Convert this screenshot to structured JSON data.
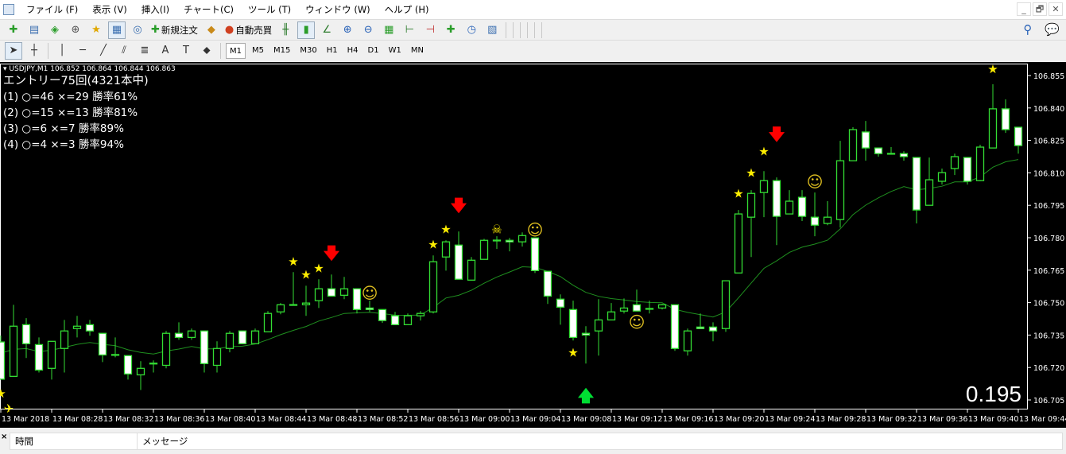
{
  "menu": [
    "ファイル (F)",
    "表示 (V)",
    "挿入(I)",
    "チャート(C)",
    "ツール (T)",
    "ウィンドウ (W)",
    "ヘルプ (H)"
  ],
  "window_controls": {
    "minimize": "_",
    "restore": "🗗",
    "close": "✕"
  },
  "toolbar1": [
    {
      "icon": "new-chart-icon",
      "glyph": "✚",
      "color": "#2a9d2a",
      "label": ""
    },
    {
      "icon": "profiles-icon",
      "glyph": "▤",
      "color": "#3b6fb0",
      "label": ""
    },
    {
      "sep": true
    },
    {
      "icon": "market-watch-icon",
      "glyph": "◈",
      "color": "#2a9d2a",
      "label": ""
    },
    {
      "icon": "data-window-icon",
      "glyph": "⊕",
      "color": "#555",
      "label": ""
    },
    {
      "icon": "navigator-icon",
      "glyph": "★",
      "color": "#e0a800",
      "label": ""
    },
    {
      "icon": "terminal-icon",
      "glyph": "▦",
      "color": "#3b6fb0",
      "label": "",
      "active": true
    },
    {
      "icon": "strategy-tester-icon",
      "glyph": "◎",
      "color": "#3b6fb0",
      "label": ""
    },
    {
      "sep": true
    },
    {
      "icon": "new-order-icon",
      "glyph": "✚",
      "color": "#2a9d2a",
      "label": "新規注文"
    },
    {
      "icon": "metaeditor-icon",
      "glyph": "◆",
      "color": "#c98a1a",
      "label": ""
    },
    {
      "icon": "autotrading-icon",
      "glyph": "●",
      "color": "#d04020",
      "label": "自動売買"
    },
    {
      "sep": true
    },
    {
      "icon": "bar-chart-icon",
      "glyph": "╫",
      "color": "#2a7a2a",
      "label": ""
    },
    {
      "icon": "candlestick-chart-icon",
      "glyph": "▮",
      "color": "#2a9d2a",
      "label": "",
      "active": true
    },
    {
      "icon": "line-chart-icon",
      "glyph": "∠",
      "color": "#2a7a2a",
      "label": ""
    },
    {
      "sep": true
    },
    {
      "icon": "zoom-in-icon",
      "glyph": "⊕",
      "color": "#2a63b8",
      "label": ""
    },
    {
      "icon": "zoom-out-icon",
      "glyph": "⊖",
      "color": "#2a63b8",
      "label": ""
    },
    {
      "icon": "tile-windows-icon",
      "glyph": "▦",
      "color": "#2a9d2a",
      "label": ""
    },
    {
      "sep": true
    },
    {
      "icon": "chart-shift-icon",
      "glyph": "⊢",
      "color": "#2a7a2a",
      "label": ""
    },
    {
      "icon": "autoscroll-icon",
      "glyph": "⊣",
      "color": "#c03030",
      "label": ""
    },
    {
      "sep": true
    },
    {
      "icon": "indicators-icon",
      "glyph": "✚",
      "color": "#2a9d2a",
      "label": ""
    },
    {
      "icon": "periods-icon",
      "glyph": "◷",
      "color": "#2a63b8",
      "label": ""
    },
    {
      "icon": "templates-icon",
      "glyph": "▧",
      "color": "#3b6fb0",
      "label": ""
    }
  ],
  "toolbar1_right": [
    {
      "icon": "search-icon",
      "glyph": "⚲"
    },
    {
      "icon": "chat-icon",
      "glyph": "💬"
    }
  ],
  "toolbar2_tools": [
    {
      "icon": "cursor-icon",
      "glyph": "➤"
    },
    {
      "icon": "crosshair-icon",
      "glyph": "┼"
    },
    {
      "sep": true
    },
    {
      "icon": "vertical-line-icon",
      "glyph": "│"
    },
    {
      "icon": "horizontal-line-icon",
      "glyph": "─"
    },
    {
      "icon": "trendline-icon",
      "glyph": "╱"
    },
    {
      "icon": "equidistant-channel-icon",
      "glyph": "⫽"
    },
    {
      "icon": "fibonacci-icon",
      "glyph": "≣"
    },
    {
      "icon": "text-icon",
      "glyph": "A"
    },
    {
      "icon": "text-label-icon",
      "glyph": "T"
    },
    {
      "icon": "arrows-icon",
      "glyph": "⬥"
    }
  ],
  "timeframes": [
    "M1",
    "M5",
    "M15",
    "M30",
    "H1",
    "H4",
    "D1",
    "W1",
    "MN"
  ],
  "active_timeframe": "M1",
  "chart": {
    "header": "USDJPY,M1  106.852 106.864 106.844 106.863",
    "stats": [
      "エントリー75回(4321本中)",
      "(1) ○=46 ×=29 勝率61%",
      "(2) ○=15 ×=13 勝率81%",
      "(3) ○=6 ×=7 勝率89%",
      "(4) ○=4 ×=3 勝率94%"
    ],
    "big_value": "0.195"
  },
  "chart_data": {
    "type": "candlestick",
    "symbol": "USDJPY",
    "timeframe": "M1",
    "ylim": [
      106.7,
      106.86
    ],
    "yticks": [
      "106.855",
      "106.840",
      "106.825",
      "106.810",
      "106.795",
      "106.780",
      "106.765",
      "106.750",
      "106.735",
      "106.720",
      "106.705"
    ],
    "xticks": [
      "13 Mar 2018",
      "13 Mar 08:28",
      "13 Mar 08:32",
      "13 Mar 08:36",
      "13 Mar 08:40",
      "13 Mar 08:44",
      "13 Mar 08:48",
      "13 Mar 08:52",
      "13 Mar 08:56",
      "13 Mar 09:00",
      "13 Mar 09:04",
      "13 Mar 09:08",
      "13 Mar 09:12",
      "13 Mar 09:16",
      "13 Mar 09:20",
      "13 Mar 09:24",
      "13 Mar 09:28",
      "13 Mar 09:32",
      "13 Mar 09:36",
      "13 Mar 09:40",
      "13 Mar 09:44"
    ],
    "colors": {
      "background": "#000000",
      "candle_outline": "#33dd33",
      "bear_fill": "#ffffff",
      "bull_fill": "#000000",
      "ma_line": "#1f8f1f",
      "star": "#ffee00",
      "arrow_down": "#ff0000",
      "arrow_up": "#00dd33",
      "smiley": "#e0c020"
    },
    "candles_columns": [
      "time",
      "open",
      "high",
      "low",
      "close"
    ],
    "candles": [
      [
        "08:24",
        106.7318,
        106.7348,
        106.7146,
        106.7146
      ],
      [
        "08:25",
        106.7159,
        106.749,
        106.7159,
        106.7391
      ],
      [
        "08:26",
        106.7398,
        106.7428,
        106.7244,
        106.731
      ],
      [
        "08:27",
        106.7306,
        106.7339,
        106.7177,
        106.7188
      ],
      [
        "08:28",
        106.7196,
        106.7321,
        106.7144,
        106.7321
      ],
      [
        "08:29",
        106.7288,
        106.742,
        106.7177,
        106.7369
      ],
      [
        "08:30",
        106.738,
        106.7439,
        106.7339,
        106.7391
      ],
      [
        "08:31",
        106.7398,
        106.742,
        106.7347,
        106.7369
      ],
      [
        "08:32",
        106.7358,
        106.7358,
        106.7225,
        106.7258
      ],
      [
        "08:33",
        106.726,
        106.7339,
        106.7247,
        106.726
      ],
      [
        "08:34",
        106.7255,
        106.7255,
        106.7144,
        106.717
      ],
      [
        "08:35",
        106.7166,
        106.7229,
        106.7096,
        106.7196
      ],
      [
        "08:36",
        106.7218,
        106.7233,
        106.7177,
        106.722
      ],
      [
        "08:37",
        106.721,
        106.7369,
        106.7196,
        106.7358
      ],
      [
        "08:38",
        106.7358,
        106.7409,
        106.7328,
        106.7339
      ],
      [
        "08:39",
        106.7339,
        106.738,
        106.7328,
        106.7369
      ],
      [
        "08:40",
        106.7369,
        106.7369,
        106.7177,
        106.7218
      ],
      [
        "08:41",
        106.721,
        106.7321,
        106.7177,
        106.7288
      ],
      [
        "08:42",
        106.7288,
        106.7369,
        106.727,
        106.7358
      ],
      [
        "08:43",
        106.7369,
        106.7369,
        106.731,
        106.731
      ],
      [
        "08:44",
        106.731,
        106.738,
        106.731,
        106.7369
      ],
      [
        "08:45",
        106.7365,
        106.7461,
        106.7365,
        106.745
      ],
      [
        "08:46",
        106.7457,
        106.7498,
        106.7446,
        106.749
      ],
      [
        "08:47",
        106.749,
        106.7641,
        106.749,
        106.7491
      ],
      [
        "08:48",
        106.749,
        106.7578,
        106.7439,
        106.7498
      ],
      [
        "08:49",
        106.7509,
        106.7608,
        106.7475,
        106.7564
      ],
      [
        "08:50",
        106.7564,
        106.763,
        106.753,
        106.753
      ],
      [
        "08:51",
        106.7534,
        106.7619,
        106.7516,
        106.7564
      ],
      [
        "08:52",
        106.7564,
        106.7564,
        106.745,
        106.7468
      ],
      [
        "08:53",
        106.7475,
        106.7509,
        106.7457,
        106.7468
      ],
      [
        "08:54",
        106.7468,
        106.7468,
        106.7406,
        106.7417
      ],
      [
        "08:55",
        106.7439,
        106.7457,
        106.7398,
        106.7398
      ],
      [
        "08:56",
        106.7398,
        106.745,
        106.7398,
        106.7439
      ],
      [
        "08:57",
        106.7439,
        106.7461,
        106.7417,
        106.745
      ],
      [
        "08:58",
        106.7457,
        106.7718,
        106.745,
        106.7689
      ],
      [
        "08:59",
        106.7711,
        106.7788,
        106.7648,
        106.7781
      ],
      [
        "09:00",
        106.7766,
        106.7829,
        106.7608,
        106.7608
      ],
      [
        "09:01",
        106.7604,
        106.7711,
        106.7604,
        106.7696
      ],
      [
        "09:02",
        106.77,
        106.7795,
        106.77,
        106.7788
      ],
      [
        "09:03",
        106.7788,
        106.7807,
        106.7748,
        106.7789
      ],
      [
        "09:04",
        106.7788,
        106.7799,
        106.7737,
        106.7781
      ],
      [
        "09:05",
        106.7781,
        106.7825,
        106.7759,
        106.781
      ],
      [
        "09:06",
        106.7799,
        106.7799,
        106.7637,
        106.7648
      ],
      [
        "09:07",
        106.7645,
        106.7645,
        106.7494,
        106.753
      ],
      [
        "09:08",
        106.7516,
        106.7538,
        106.7398,
        106.7479
      ],
      [
        "09:09",
        106.7468,
        106.7509,
        106.7325,
        106.7339
      ],
      [
        "09:10",
        106.7358,
        106.7391,
        106.7218,
        106.735
      ],
      [
        "09:11",
        106.7369,
        106.7516,
        106.7255,
        106.742
      ],
      [
        "09:12",
        106.742,
        106.7498,
        106.742,
        106.7457
      ],
      [
        "09:13",
        106.7461,
        106.7519,
        106.745,
        106.7475
      ],
      [
        "09:14",
        106.749,
        106.756,
        106.7461,
        106.7461
      ],
      [
        "09:15",
        106.7472,
        106.7509,
        106.745,
        106.7473
      ],
      [
        "09:16",
        106.7475,
        106.7494,
        106.7468,
        106.749
      ],
      [
        "09:17",
        106.749,
        106.749,
        106.7277,
        106.7288
      ],
      [
        "09:18",
        106.7277,
        106.738,
        106.7255,
        106.7369
      ],
      [
        "09:19",
        106.7387,
        106.745,
        106.738,
        106.738
      ],
      [
        "09:20",
        106.7387,
        106.7409,
        106.7321,
        106.7369
      ],
      [
        "09:21",
        106.738,
        106.7601,
        106.7365,
        106.7601
      ],
      [
        "09:22",
        106.7637,
        106.7928,
        106.7637,
        106.791
      ],
      [
        "09:23",
        106.7895,
        106.802,
        106.7711,
        106.8005
      ],
      [
        "09:24",
        106.8009,
        106.8108,
        106.7895,
        106.8064
      ],
      [
        "09:25",
        106.8064,
        106.8079,
        106.7766,
        106.7899
      ],
      [
        "09:26",
        106.791,
        106.802,
        106.791,
        106.7969
      ],
      [
        "09:27",
        106.7987,
        106.802,
        106.7877,
        106.7899
      ],
      [
        "09:28",
        106.7895,
        106.8009,
        106.7807,
        106.7858
      ],
      [
        "09:29",
        106.7866,
        106.7969,
        106.7858,
        106.7895
      ],
      [
        "09:30",
        106.7884,
        106.8248,
        106.7847,
        106.8156
      ],
      [
        "09:31",
        106.8156,
        106.8311,
        106.8156,
        106.83
      ],
      [
        "09:32",
        106.8289,
        106.834,
        106.8156,
        106.8215
      ],
      [
        "09:33",
        106.8215,
        106.8215,
        106.8175,
        106.8189
      ],
      [
        "09:34",
        106.819,
        106.8219,
        106.8189,
        106.8189
      ],
      [
        "09:35",
        106.8189,
        106.82,
        106.8156,
        106.8175
      ],
      [
        "09:36",
        106.8171,
        106.8171,
        106.7866,
        106.7928
      ],
      [
        "09:37",
        106.795,
        106.8171,
        106.795,
        106.8068
      ],
      [
        "09:38",
        106.8061,
        106.812,
        106.8046,
        106.8101
      ],
      [
        "09:39",
        106.812,
        106.8189,
        106.809,
        106.8175
      ],
      [
        "09:40",
        106.8171,
        106.8171,
        106.8046,
        106.8061
      ],
      [
        "09:41",
        106.8064,
        106.823,
        106.8061,
        106.8219
      ],
      [
        "09:42",
        106.8215,
        106.851,
        106.8215,
        106.8396
      ],
      [
        "09:43",
        106.8396,
        106.844,
        106.8285,
        106.83
      ],
      [
        "09:44",
        106.8311,
        106.8311,
        106.8189,
        106.8226
      ]
    ],
    "moving_average": true,
    "markers": [
      {
        "type": "star",
        "time": "08:24",
        "price": 106.708
      },
      {
        "type": "airplane",
        "time": "08:24",
        "price": 106.701
      },
      {
        "type": "star",
        "time": "08:47",
        "price": 106.769
      },
      {
        "type": "star",
        "time": "08:48",
        "price": 106.763
      },
      {
        "type": "star",
        "time": "08:49",
        "price": 106.766
      },
      {
        "type": "arrow-down",
        "time": "08:50",
        "price": 106.773
      },
      {
        "type": "smiley",
        "time": "08:53",
        "price": 106.7545
      },
      {
        "type": "star",
        "time": "08:58",
        "price": 106.777
      },
      {
        "type": "star",
        "time": "08:59",
        "price": 106.784
      },
      {
        "type": "arrow-down",
        "time": "09:00",
        "price": 106.795
      },
      {
        "type": "skull",
        "time": "09:03",
        "price": 106.784
      },
      {
        "type": "smiley",
        "time": "09:06",
        "price": 106.7836
      },
      {
        "type": "star",
        "time": "09:09",
        "price": 106.727
      },
      {
        "type": "arrow-up",
        "time": "09:10",
        "price": 106.707
      },
      {
        "type": "smiley",
        "time": "09:14",
        "price": 106.741
      },
      {
        "type": "star",
        "time": "09:22",
        "price": 106.8005
      },
      {
        "type": "star",
        "time": "09:23",
        "price": 106.81
      },
      {
        "type": "star",
        "time": "09:24",
        "price": 106.82
      },
      {
        "type": "arrow-down",
        "time": "09:25",
        "price": 106.828
      },
      {
        "type": "smiley",
        "time": "09:28",
        "price": 106.806
      },
      {
        "type": "star",
        "time": "09:42",
        "price": 106.858
      }
    ]
  },
  "bottom_panel": {
    "columns": [
      "時間",
      "メッセージ"
    ],
    "close": "×"
  }
}
